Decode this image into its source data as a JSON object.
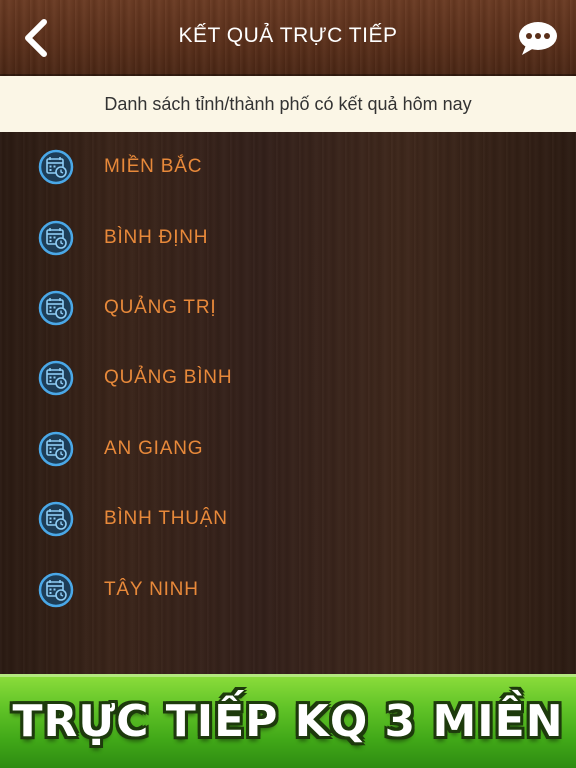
{
  "header": {
    "title": "KẾT QUẢ TRỰC TIẾP",
    "back_icon": "chevron-left-icon",
    "chat_icon": "chat-bubble-icon"
  },
  "subheader": {
    "text": "Danh sách tỉnh/thành phố có kết quả hôm nay"
  },
  "list": {
    "icon": "calendar-clock-icon",
    "items": [
      {
        "label": "MIỀN BẮC"
      },
      {
        "label": "BÌNH ĐỊNH"
      },
      {
        "label": "QUẢNG TRỊ"
      },
      {
        "label": "QUẢNG BÌNH"
      },
      {
        "label": "AN GIANG"
      },
      {
        "label": "BÌNH THUẬN"
      },
      {
        "label": "TÂY NINH"
      }
    ]
  },
  "banner": {
    "text": "TRỰC TIẾP KQ 3 MIỀN"
  },
  "colors": {
    "header_wood": "#5a2f1a",
    "subheader_bg": "#fbf6e6",
    "list_label": "#e8893a",
    "icon_blue": "#4aa8e8",
    "banner_green": "#62c428"
  }
}
